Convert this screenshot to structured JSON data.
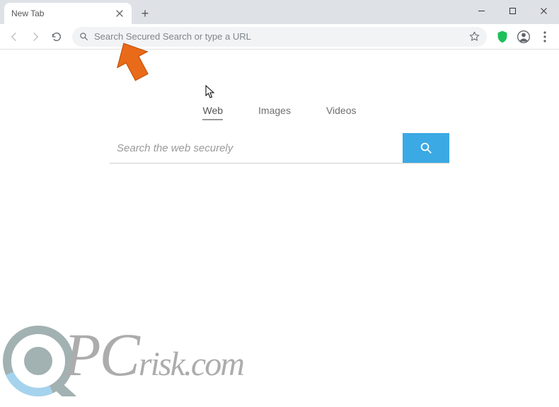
{
  "window": {
    "tab_title": "New Tab"
  },
  "toolbar": {
    "omnibox_placeholder": "Search Secured Search or type a URL"
  },
  "page": {
    "nav": {
      "web": "Web",
      "images": "Images",
      "videos": "Videos"
    },
    "search_placeholder": "Search the web securely"
  },
  "watermark": {
    "pc": "PC",
    "risk": "risk",
    "dot": ".",
    "com": "com"
  },
  "icons": {
    "shield_color": "#1fbf5c",
    "search_btn_color": "#3ba9e4",
    "arrow_color": "#e96a18"
  }
}
